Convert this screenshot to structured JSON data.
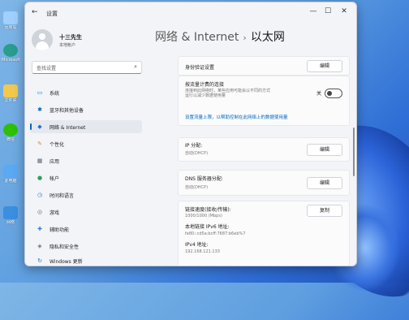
{
  "desktop": {
    "icons": [
      {
        "label": "回收站",
        "color": "#9fd0ff",
        "icon": "recycle-bin-icon"
      },
      {
        "label": "Microsoft Edge",
        "color": "#2a9d8f",
        "icon": "edge-icon"
      },
      {
        "label": "文件夹",
        "color": "#f2c94c",
        "icon": "folder-icon"
      },
      {
        "label": "微信",
        "color": "#2dc100",
        "icon": "wechat-icon"
      },
      {
        "label": "此电脑",
        "color": "#5aa9f5",
        "icon": "computer-icon"
      },
      {
        "label": "网络",
        "color": "#3a8fe0",
        "icon": "network-icon"
      }
    ]
  },
  "window": {
    "app_title": "设置",
    "back_icon": "←",
    "min_icon": "—",
    "max_icon": "☐",
    "close_icon": "✕"
  },
  "user": {
    "name": "十三先生",
    "type": "本地帐户"
  },
  "search": {
    "placeholder": "查找设置",
    "icon": "⌕"
  },
  "nav": [
    {
      "label": "系统",
      "icon": "▭",
      "color": "#0078d4"
    },
    {
      "label": "蓝牙和其他设备",
      "icon": "✱",
      "color": "#0067c0"
    },
    {
      "label": "网络 & Internet",
      "icon": "◆",
      "color": "#1f6fd1",
      "active": true
    },
    {
      "label": "个性化",
      "icon": "✎",
      "color": "#d08a2e"
    },
    {
      "label": "应用",
      "icon": "▦",
      "color": "#5a6472"
    },
    {
      "label": "帐户",
      "icon": "●",
      "color": "#2fa05b"
    },
    {
      "label": "时间和语言",
      "icon": "◷",
      "color": "#2b7cd3"
    },
    {
      "label": "游戏",
      "icon": "◎",
      "color": "#6b6f78"
    },
    {
      "label": "辅助功能",
      "icon": "✚",
      "color": "#3d7ad6"
    },
    {
      "label": "隐私和安全性",
      "icon": "◈",
      "color": "#6a6f78"
    },
    {
      "label": "Windows 更新",
      "icon": "↻",
      "color": "#0a6fd0"
    }
  ],
  "breadcrumb": {
    "parent": "网络 & Internet",
    "sep": "›",
    "current": "以太网"
  },
  "settings": {
    "auth": {
      "label": "身份验证设置",
      "button": "编辑"
    },
    "metered": {
      "label": "按流量计费的连接",
      "desc": "连接到此网络时，某些应用可能会以不同的方式运行以减少数据使用量",
      "state": "关",
      "on": false
    },
    "data_link": "设置流量上限，以帮助控制在此网络上的数据使用量",
    "ip": {
      "label": "IP 分配:",
      "value": "自动(DHCP)",
      "button": "编辑"
    },
    "dns": {
      "label": "DNS 服务器分配:",
      "value": "自动(DHCP)",
      "button": "编辑"
    },
    "info": {
      "speed_label": "链接速度(接收/传输):",
      "speed_value": "1000/1000 (Mbps)",
      "ipv6_label": "本地链接 IPv6 地址:",
      "ipv6_value": "fe80::cd5a:bcff:7687:b6eb%7",
      "ipv4_label": "IPv4 地址:",
      "ipv4_value": "192.168.121.133",
      "button": "复制"
    }
  }
}
